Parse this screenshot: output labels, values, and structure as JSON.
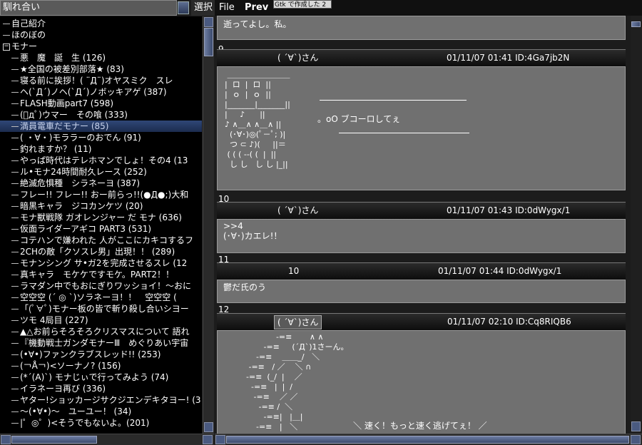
{
  "board": {
    "name": "馴れ合い",
    "select_label": "選択"
  },
  "menu": {
    "file": "File",
    "prev": "Prev",
    "tooltip": "Gtk で作成した 2"
  },
  "tree": [
    {
      "label": "自己紹介",
      "type": "leaf-top"
    },
    {
      "label": "ほのぼの",
      "type": "leaf-top"
    },
    {
      "label": "モナー",
      "type": "folder"
    },
    {
      "label": "悪　魔　誕　生 (126)",
      "type": "leaf"
    },
    {
      "label": "★全国の被差別部落★ (83)",
      "type": "leaf"
    },
    {
      "label": "寝る前に挨拶！( ¨Д¨)オヤスミク　スレ",
      "type": "leaf"
    },
    {
      "label": "ヘ(`Д´)ノヘ(`Д´)ノボッキアゲ (387)",
      "type": "leaf"
    },
    {
      "label": "FLASH動画part7 (598)",
      "type": "leaf"
    },
    {
      "label": "(ﾟдﾟ)ウマー　その喰 (333)",
      "type": "leaf"
    },
    {
      "label": "満員電車だモナー (85)",
      "type": "leaf",
      "selected": true
    },
    {
      "label": "( ・∀・)モララーのおでん (91)",
      "type": "leaf"
    },
    {
      "label": "釣れますか？ (11)",
      "type": "leaf"
    },
    {
      "label": "やっぱ時代はテレホマンでしょ！その4 (13",
      "type": "leaf"
    },
    {
      "label": "ル•モナ24時間耐久レース (252)",
      "type": "leaf"
    },
    {
      "label": "絶滅危惧種　シラネーヨ (387)",
      "type": "leaf"
    },
    {
      "label": "フレー!! フレー!! おー前らっ!!(●Д●;)大和",
      "type": "leaf"
    },
    {
      "label": "暗黒キャラ　ジコカンケツ (20)",
      "type": "leaf"
    },
    {
      "label": "モナ獣戦隊 ガオレンジャー だ モナ (636)",
      "type": "leaf"
    },
    {
      "label": "仮面ライダーアギコ PART3 (531)",
      "type": "leaf"
    },
    {
      "label": "コテハンで嫌われた 人がここにカキコするフ",
      "type": "leaf"
    },
    {
      "label": "2CHの敵「クソスレ男」出現！！ (289)",
      "type": "leaf"
    },
    {
      "label": "モナンシング サ•ガ2を完成させるスレ (12",
      "type": "leaf"
    },
    {
      "label": "真キャラ　モケケですモケ。PART2！！",
      "type": "leaf"
    },
    {
      "label": "ラマダン中でもおにぎりワッショイ！～おに",
      "type": "leaf"
    },
    {
      "label": "空空空 (´ ◎ `)ソラネーヨ！！　空空空 (",
      "type": "leaf"
    },
    {
      "label": "「(ﾟ∀ﾟ)モナー板の皆で斬り殺し合いシヨー",
      "type": "leaf"
    },
    {
      "label": "ツモ 4局目 (227)",
      "type": "leaf"
    },
    {
      "label": "▲△お前らそろそろクリスマスについて 語れ",
      "type": "leaf"
    },
    {
      "label": "『機動戦士ガンダモナーⅢ　めぐりあい宇宙",
      "type": "leaf"
    },
    {
      "label": "(•∀•)ファンクラブスレッド!! (253)",
      "type": "leaf"
    },
    {
      "label": "(￢Å￢)<ソーナノ? (156)",
      "type": "leaf"
    },
    {
      "label": "(*´(A)`) モナじぃで行ってみよう (74)",
      "type": "leaf"
    },
    {
      "label": "イラネーヨ再び (336)",
      "type": "leaf"
    },
    {
      "label": "ヤター!ショッカージサクジエンデキタヨー! (3",
      "type": "leaf"
    },
    {
      "label": "～(•∀•)～　ユーユー！ (34)",
      "type": "leaf"
    },
    {
      "label": "|゜◎゜)<そうでもないよ。(201)",
      "type": "leaf"
    }
  ],
  "posts": [
    {
      "body": "逝ってよし。私。"
    },
    {
      "num": "9",
      "name": "( ´∀`)さん",
      "date": "01/11/07 01:41 ID:4Ga7jb2N",
      "aa": [
        " ＿＿＿＿＿＿＿＿",
        "|  ロ  |  ロ  ||",
        "|  ｏ  |  ｏ  ||",
        "|_______|_______||",
        "|     ♪      ||",
        "♪ ∧＿∧ ∧＿∧ ||",
        "  (･∀･)◎(ﾟ－ﾟ; )|",
        "  つ ⊂ ♪)(     ||＝",
        " ( ( ( --( (  |  ||",
        "  し し   し し |_||"
      ],
      "bubble": "。oO ブコーロしてぇ"
    },
    {
      "num": "10",
      "name": "( ´∀`)さん",
      "date": "01/11/07 01:43 ID:0dWygx/1",
      "body": ">>4\n(･∀･)カエレ!！"
    },
    {
      "num": "11",
      "name": "10",
      "date": "01/11/07 01:44 ID:0dWygx/1",
      "body": "鬱だ氏のう"
    },
    {
      "num": "12",
      "name": "( ´∀`)さん",
      "date": "01/11/07 02:10 ID:Cq8RIQB6",
      "aa": [
        "            -=≡       ∧ ∧",
        "       -=≡     (´Д`)1さーん。",
        "    -=≡    ＿＿_/   ＼",
        " -=≡   / ／    ＼ ∩",
        "-=≡  (_/  |    ／",
        "  -=≡   |  |  /",
        "   -=≡    ／ ／",
        "     -=≡ /  ＼",
        "       -=≡|   |＿|",
        "    -=≡   |   ＼"
      ],
      "shout": "＼ 速く！もっと速く逃げてぇ！ ／"
    }
  ]
}
